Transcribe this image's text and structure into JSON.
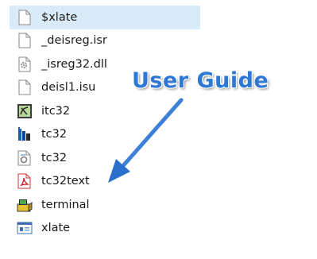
{
  "files": [
    {
      "name": "$xlate",
      "icon": "blank-file-icon",
      "selected": true
    },
    {
      "name": "_deisreg.isr",
      "icon": "blank-file-icon"
    },
    {
      "name": "_isreg32.dll",
      "icon": "dll-file-icon"
    },
    {
      "name": "deisl1.isu",
      "icon": "blank-file-icon"
    },
    {
      "name": "itc32",
      "icon": "itc-app-icon"
    },
    {
      "name": "tc32",
      "icon": "tc-app-icon"
    },
    {
      "name": "tc32",
      "icon": "config-file-icon"
    },
    {
      "name": "tc32text",
      "icon": "pdf-file-icon"
    },
    {
      "name": "terminal",
      "icon": "terminal-app-icon"
    },
    {
      "name": "xlate",
      "icon": "window-app-icon"
    }
  ],
  "overlay": {
    "title": "User Guide",
    "color": "#2e78d6"
  }
}
